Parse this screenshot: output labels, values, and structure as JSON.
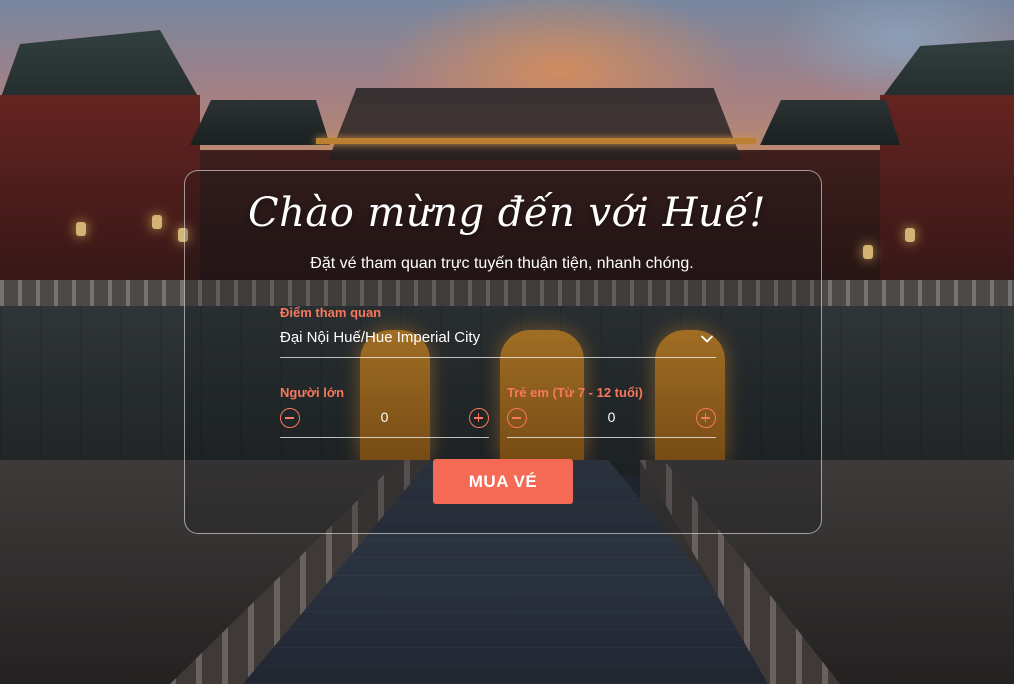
{
  "hero": {
    "title": "Chào mừng đến với Huế!",
    "subtitle": "Đặt vé tham quan trực tuyến thuận tiện, nhanh chóng.",
    "background_icon": "imperial-city-gate-photo"
  },
  "booking_form": {
    "destination": {
      "label": "Điểm tham quan",
      "selected": "Đại Nội Huế/Hue Imperial City",
      "icon": "chevron-down-icon"
    },
    "adults": {
      "label": "Người lớn",
      "value": "0",
      "decrement_icon": "minus-circle-icon",
      "increment_icon": "plus-circle-icon"
    },
    "children": {
      "label": "Trẻ em (Từ 7 - 12 tuổi)",
      "value": "0",
      "decrement_icon": "minus-circle-icon",
      "increment_icon": "plus-circle-icon"
    },
    "submit_label": "MUA VÉ"
  },
  "colors": {
    "accent": "#f46a55",
    "label": "#f7785c",
    "text": "#ffffff"
  }
}
